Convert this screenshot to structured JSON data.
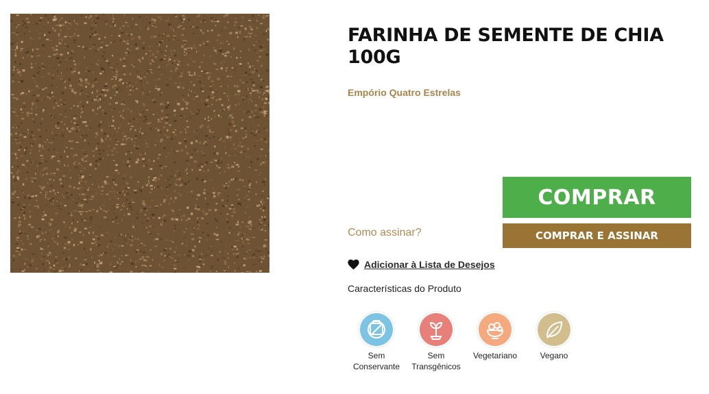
{
  "product": {
    "title": "FARINHA DE SEMENTE DE CHIA 100G",
    "brand": "Empório Quatro Estrelas",
    "image_colors": [
      "#6e5234",
      "#8a6a45",
      "#a9875c",
      "#4f3820",
      "#c0a27a"
    ]
  },
  "purchase": {
    "buy_label": "COMPRAR",
    "subscribe_label": "COMPRAR E ASSINAR",
    "how_subscribe_label": "Como assinar?",
    "buy_color": "#4eae4a",
    "subscribe_color": "#9a7434"
  },
  "wishlist": {
    "label": "Adicionar à Lista de Desejos",
    "icon": "heart-icon"
  },
  "features": {
    "heading": "Características do Produto",
    "items": [
      {
        "caption": "Sem\nConservante",
        "icon": "no-preservatives-icon",
        "color": "#7cc3e4"
      },
      {
        "caption": "Sem\nTransgênicos",
        "icon": "sprout-icon",
        "color": "#e8807a"
      },
      {
        "caption": "Vegetariano",
        "icon": "salad-bowl-icon",
        "color": "#f5a97e"
      },
      {
        "caption": "Vegano",
        "icon": "leaf-icon",
        "color": "#d2bd8c"
      }
    ]
  }
}
